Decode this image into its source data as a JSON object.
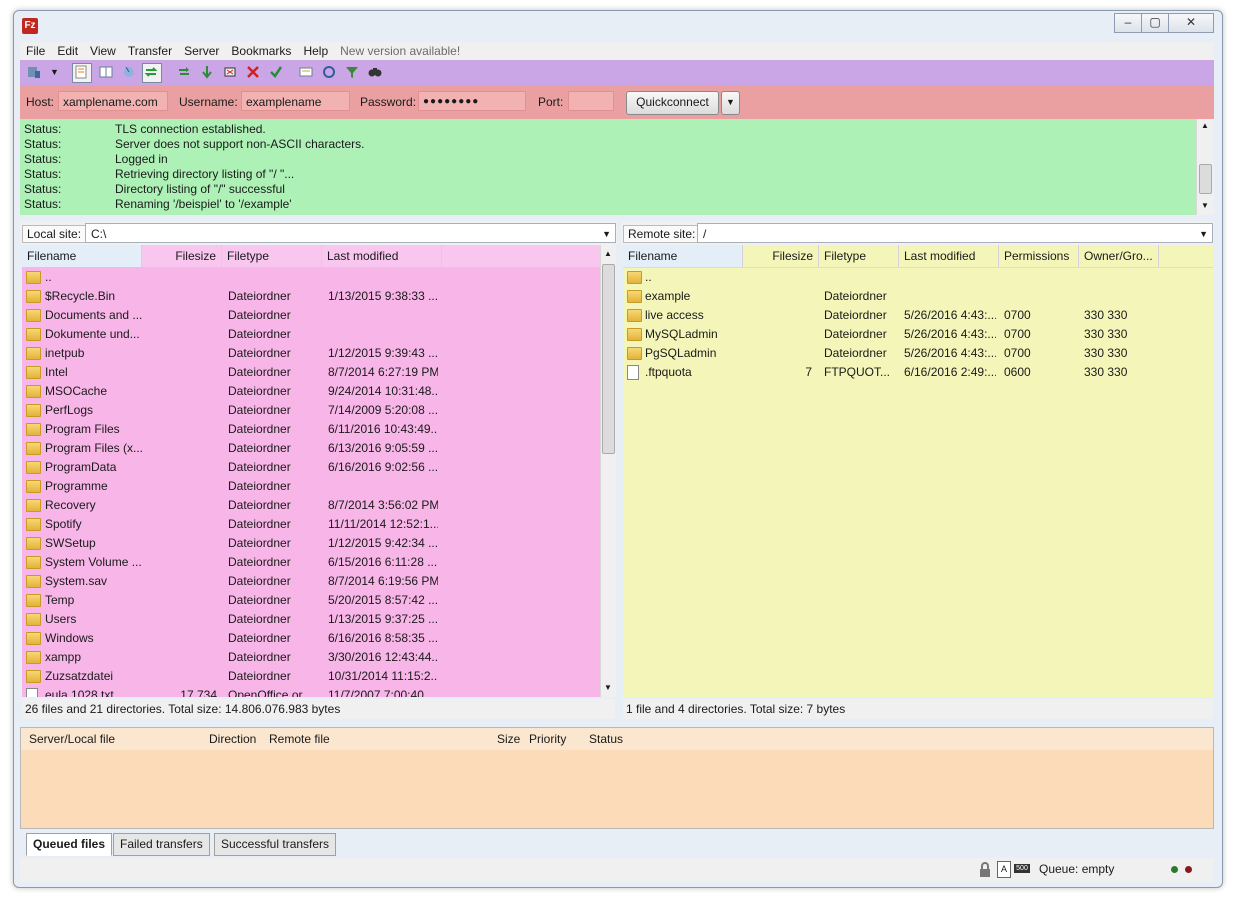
{
  "menu": [
    "File",
    "Edit",
    "View",
    "Transfer",
    "Server",
    "Bookmarks",
    "Help",
    "New version available!"
  ],
  "toolbar": {
    "icons": [
      "site-manager-icon",
      "dropdown-arrow-icon",
      "toggle-message-log-icon",
      "toggle-local-tree-icon",
      "toggle-remote-tree-icon",
      "toggle-queue-icon",
      "refresh-icon",
      "process-queue-icon",
      "cancel-operation-icon",
      "disconnect-icon",
      "reconnect-icon",
      "directory-comparison-icon",
      "sync-browsing-icon",
      "filter-icon",
      "search-icon"
    ]
  },
  "quickconnect": {
    "host_label": "Host:",
    "host_value": "xamplename.com",
    "username_label": "Username:",
    "username_value": "examplename",
    "password_label": "Password:",
    "password_value": "●●●●●●●●",
    "port_label": "Port:",
    "port_value": "",
    "button": "Quickconnect"
  },
  "log": [
    {
      "k": "Status:",
      "v": "TLS connection established."
    },
    {
      "k": "Status:",
      "v": "Server does not support non-ASCII characters."
    },
    {
      "k": "Status:",
      "v": "Logged in"
    },
    {
      "k": "Status:",
      "v": "Retrieving directory listing of \"/ \"..."
    },
    {
      "k": "Status:",
      "v": "Directory listing of \"/\" successful"
    },
    {
      "k": "Status:",
      "v": "Renaming '/beispiel' to '/example'"
    }
  ],
  "local": {
    "site_label": "Local site:",
    "path": "C:\\",
    "headers": [
      "Filename",
      "Filesize",
      "Filetype",
      "Last modified"
    ],
    "rows": [
      {
        "name": "..",
        "size": "",
        "type": "",
        "modified": "",
        "icon": "folder"
      },
      {
        "name": "$Recycle.Bin",
        "size": "",
        "type": "Dateiordner",
        "modified": "1/13/2015 9:38:33 ...",
        "icon": "folder"
      },
      {
        "name": "Documents and ...",
        "size": "",
        "type": "Dateiordner",
        "modified": "",
        "icon": "folder"
      },
      {
        "name": "Dokumente und...",
        "size": "",
        "type": "Dateiordner",
        "modified": "",
        "icon": "folder"
      },
      {
        "name": "inetpub",
        "size": "",
        "type": "Dateiordner",
        "modified": "1/12/2015 9:39:43 ...",
        "icon": "folder"
      },
      {
        "name": "Intel",
        "size": "",
        "type": "Dateiordner",
        "modified": "8/7/2014 6:27:19 PM",
        "icon": "folder"
      },
      {
        "name": "MSOCache",
        "size": "",
        "type": "Dateiordner",
        "modified": "9/24/2014 10:31:48...",
        "icon": "folder"
      },
      {
        "name": "PerfLogs",
        "size": "",
        "type": "Dateiordner",
        "modified": "7/14/2009 5:20:08 ...",
        "icon": "folder"
      },
      {
        "name": "Program Files",
        "size": "",
        "type": "Dateiordner",
        "modified": "6/11/2016 10:43:49...",
        "icon": "folder"
      },
      {
        "name": "Program Files (x...",
        "size": "",
        "type": "Dateiordner",
        "modified": "6/13/2016 9:05:59 ...",
        "icon": "folder"
      },
      {
        "name": "ProgramData",
        "size": "",
        "type": "Dateiordner",
        "modified": "6/16/2016 9:02:56 ...",
        "icon": "folder"
      },
      {
        "name": "Programme",
        "size": "",
        "type": "Dateiordner",
        "modified": "",
        "icon": "folder"
      },
      {
        "name": "Recovery",
        "size": "",
        "type": "Dateiordner",
        "modified": "8/7/2014 3:56:02 PM",
        "icon": "folder"
      },
      {
        "name": "Spotify",
        "size": "",
        "type": "Dateiordner",
        "modified": "11/11/2014 12:52:1...",
        "icon": "folder"
      },
      {
        "name": "SWSetup",
        "size": "",
        "type": "Dateiordner",
        "modified": "1/12/2015 9:42:34 ...",
        "icon": "folder"
      },
      {
        "name": "System Volume ...",
        "size": "",
        "type": "Dateiordner",
        "modified": "6/15/2016 6:11:28 ...",
        "icon": "folder"
      },
      {
        "name": "System.sav",
        "size": "",
        "type": "Dateiordner",
        "modified": "8/7/2014 6:19:56 PM",
        "icon": "folder"
      },
      {
        "name": "Temp",
        "size": "",
        "type": "Dateiordner",
        "modified": "5/20/2015 8:57:42 ...",
        "icon": "folder"
      },
      {
        "name": "Users",
        "size": "",
        "type": "Dateiordner",
        "modified": "1/13/2015 9:37:25 ...",
        "icon": "folder"
      },
      {
        "name": "Windows",
        "size": "",
        "type": "Dateiordner",
        "modified": "6/16/2016 8:58:35 ...",
        "icon": "folder"
      },
      {
        "name": "xampp",
        "size": "",
        "type": "Dateiordner",
        "modified": "3/30/2016 12:43:44...",
        "icon": "folder"
      },
      {
        "name": "Zuzsatzdatei",
        "size": "",
        "type": "Dateiordner",
        "modified": "10/31/2014 11:15:2...",
        "icon": "folder"
      },
      {
        "name": "eula.1028.txt",
        "size": "17,734",
        "type": "OpenOffice.or...",
        "modified": "11/7/2007 7:00:40 ...",
        "icon": "file"
      }
    ],
    "status": "26 files and 21 directories. Total size: 14.806.076.983 bytes"
  },
  "remote": {
    "site_label": "Remote site:",
    "path": "/",
    "headers": [
      "Filename",
      "Filesize",
      "Filetype",
      "Last modified",
      "Permissions",
      "Owner/Gro..."
    ],
    "rows": [
      {
        "name": "..",
        "size": "",
        "type": "",
        "modified": "",
        "perm": "",
        "owner": "",
        "icon": "folder"
      },
      {
        "name": "example",
        "size": "",
        "type": "Dateiordner",
        "modified": "",
        "perm": "",
        "owner": "",
        "icon": "folder"
      },
      {
        "name": "live access",
        "size": "",
        "type": "Dateiordner",
        "modified": "5/26/2016 4:43:...",
        "perm": "0700",
        "owner": "330 330",
        "icon": "folder"
      },
      {
        "name": "MySQLadmin",
        "size": "",
        "type": "Dateiordner",
        "modified": "5/26/2016 4:43:...",
        "perm": "0700",
        "owner": "330 330",
        "icon": "folder"
      },
      {
        "name": "PgSQLadmin",
        "size": "",
        "type": "Dateiordner",
        "modified": "5/26/2016 4:43:...",
        "perm": "0700",
        "owner": "330 330",
        "icon": "folder"
      },
      {
        "name": ".ftpquota",
        "size": "7",
        "type": "FTPQUOT...",
        "modified": "6/16/2016 2:49:...",
        "perm": "0600",
        "owner": "330 330",
        "icon": "file"
      }
    ],
    "status": "1 file and 4 directories. Total size: 7 bytes"
  },
  "queue": {
    "headers": [
      "Server/Local file",
      "Direction",
      "Remote file",
      "Size",
      "Priority",
      "Status"
    ],
    "tabs": [
      "Queued files",
      "Failed transfers",
      "Successful transfers"
    ],
    "status": "Queue: empty"
  },
  "colors": {
    "toolbar": "#cba6e6",
    "quickconnect": "#eaa0a0",
    "log": "#aef1b6",
    "local": "#f7b5e8",
    "remote": "#f3f6b8",
    "queue": "#fcdcb8"
  }
}
